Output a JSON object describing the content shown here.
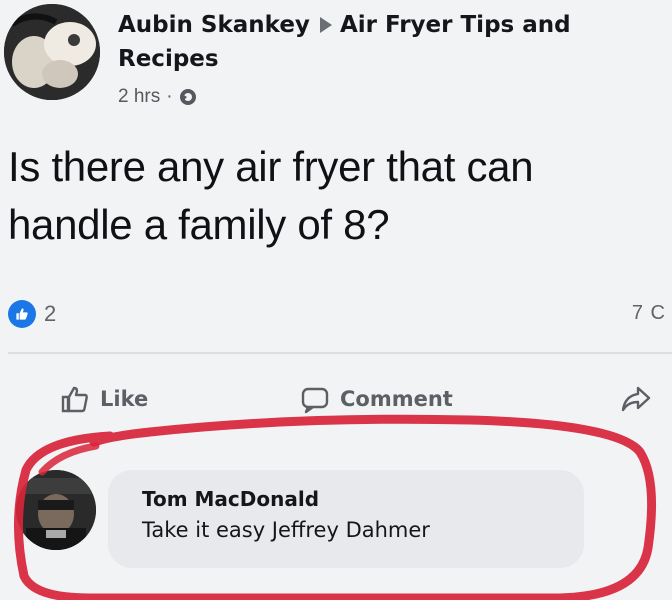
{
  "post": {
    "author": "Aubin Skankey",
    "group": "Air Fryer Tips and",
    "group_line2": "Recipes",
    "time": "2 hrs",
    "separator": "·",
    "privacy_icon": "globe-icon",
    "text": "Is there any air fryer that can handle a family of 8?"
  },
  "stats": {
    "reaction_count": "2",
    "comment_count": "7 C"
  },
  "actions": {
    "like_label": "Like",
    "comment_label": "Comment",
    "share_icon": "share-icon"
  },
  "comment": {
    "author": "Tom MacDonald",
    "text": "Take it easy Jeffrey Dahmer"
  },
  "colors": {
    "highlight": "#d8243a",
    "like_blue": "#1c77e6",
    "bubble": "#e7e9ed",
    "background": "#f2f3f5"
  }
}
